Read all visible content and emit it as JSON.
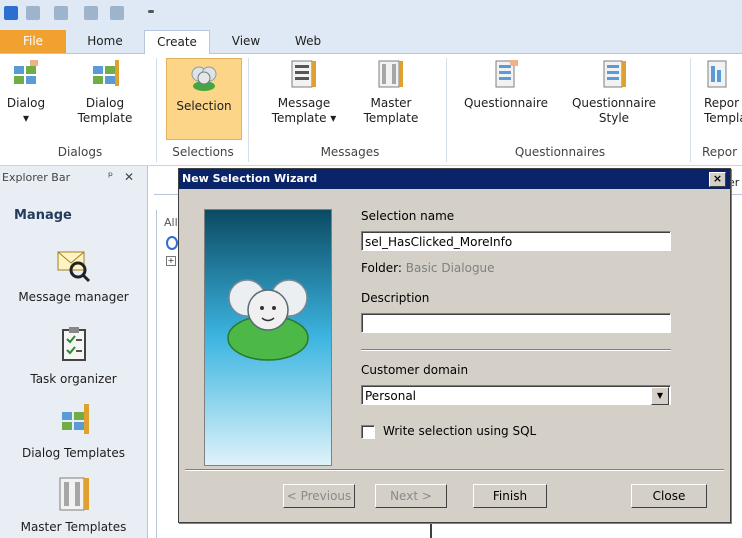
{
  "ribbon": {
    "tabs": [
      {
        "label": "File"
      },
      {
        "label": "Home"
      },
      {
        "label": "Create"
      },
      {
        "label": "View"
      },
      {
        "label": "Web"
      }
    ],
    "active_tab": "Create",
    "buttons": {
      "dialog": "Dialog",
      "dialog_template_1": "Dialog",
      "dialog_template_2": "Template",
      "selection": "Selection",
      "message_template_1": "Message",
      "message_template_2": "Template ▾",
      "master_template_1": "Master",
      "master_template_2": "Template",
      "questionnaire": "Questionnaire",
      "questionnaire_style_1": "Questionnaire",
      "questionnaire_style_2": "Style",
      "report_1": "Repor",
      "report_2": "Templa"
    },
    "groups": {
      "dialogs": "Dialogs",
      "selections": "Selections",
      "messages": "Messages",
      "questionnaires": "Questionnaires",
      "reports": "Repor"
    }
  },
  "explorer": {
    "title": "Explorer Bar",
    "pin": "ᵖ",
    "close": "✕",
    "section": "Manage",
    "items": [
      {
        "label": "Message manager"
      },
      {
        "label": "Task organizer"
      },
      {
        "label": "Dialog Templates"
      },
      {
        "label": "Master Templates"
      }
    ]
  },
  "workspace": {
    "tree_all": "All",
    "tab_fragment": "er"
  },
  "dialog": {
    "title": "New Selection Wizard",
    "close": "×",
    "selection_name_label": "Selection name",
    "selection_name_value": "sel_HasClicked_MoreInfo",
    "folder_label": "Folder:",
    "folder_value": "Basic Dialogue",
    "description_label": "Description",
    "description_value": "",
    "customer_domain_label": "Customer domain",
    "customer_domain_value": "Personal",
    "sql_checkbox_label": "Write selection using SQL",
    "sql_checked": false,
    "previous_label": "< Previous",
    "next_label": "Next >",
    "finish_label": "Finish",
    "close_label": "Close"
  },
  "colors": {
    "title_bar": "#0a246a",
    "dialog_face": "#d4d0c8",
    "file_tab": "#f0a130",
    "selected_button": "#fcd589",
    "banner_top": "#0b4a63",
    "banner_bottom": "#dff2fa"
  }
}
